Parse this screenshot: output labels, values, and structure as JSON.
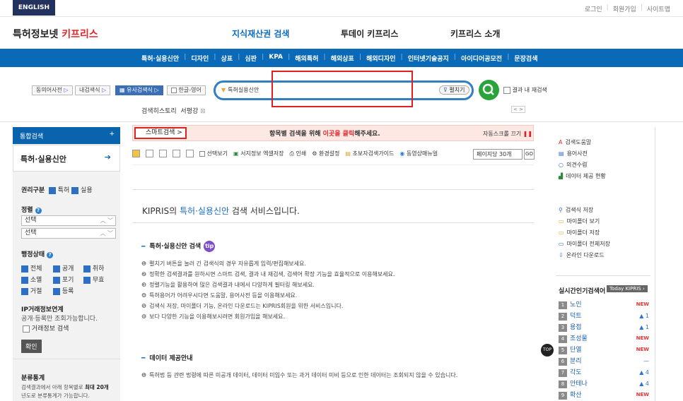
{
  "topbar": {
    "english": "ENGLISH",
    "links": [
      "로그인",
      "회원가입",
      "사이트맵"
    ]
  },
  "logo": {
    "prefix": "특허정보넷 ",
    "brand": "키프리스"
  },
  "mainnav": [
    "지식재산권 검색",
    "투데이 키프리스",
    "키프리스 소개"
  ],
  "subnav": [
    "특허·실용신안",
    "디자인",
    "상표",
    "심판",
    "KPA",
    "해외특허",
    "해외상표",
    "해외디자인",
    "인터넷기술공지",
    "아이디어공모전",
    "문장검색"
  ],
  "searchopts": {
    "synonym": "동의어사전",
    "mysearch": "내검색식",
    "similar": "유사검색식",
    "hangul": "한글-영어"
  },
  "search": {
    "select": "특허실용신안",
    "expand": "펼치기",
    "within": "결과 내 재검색"
  },
  "history": {
    "label": "검색히스토리",
    "term": "서평강"
  },
  "history_nav": "< >",
  "left": {
    "head": "통합검색",
    "selected": "특허·실용신안",
    "rights_label": "권리구분",
    "rights": [
      "특허",
      "실용"
    ],
    "sort_label": "정렬",
    "sort1": "선택",
    "sort2": "선택",
    "status_label": "행정상태",
    "status": [
      "전체",
      "공개",
      "취하",
      "소멸",
      "포기",
      "무효",
      "거절",
      "등록"
    ],
    "ip_title": "IP거래정보연계",
    "ip_desc": "공개·등록만 조회가능합니다.",
    "ip_check": "거래정보 검색",
    "confirm": "확인",
    "class_title": "분류통계",
    "class_desc1": "검색결과에서 아래 항목별로 ",
    "class_desc1b": "최대 20개",
    "class_desc2": "년도로 분류통계가 가능합니다."
  },
  "banner": {
    "smart": "스마트검색 >",
    "msg_prefix": "항목별 검색을 위해 ",
    "msg_link": "이곳을 클릭",
    "msg_suffix": "해주세요.",
    "autoscroll": "자동스크롤 끄기"
  },
  "toolbar": [
    "선택보기",
    "서지정보 엑셀저장",
    "인쇄",
    "환경설정",
    "초보자검색가이드",
    "동영상매뉴얼"
  ],
  "perpage": "페이지당 30개",
  "go": "GO",
  "svc": {
    "prefix": "KIPRIS의 ",
    "hl": "특허·실용신안",
    "suffix": " 검색 서비스입니다."
  },
  "guide_title": "특허·실용신안 검색",
  "tip": "tip",
  "bullets": [
    "펼치기 버튼을 눌러 긴 검색식의 경우 자유롭게 입력/편집해보세요.",
    "정확한 검색결과를 원하시면 스마트 검색, 결과 내 재검색, 검색어 확장 기능을 효율적으로 이용해보세요.",
    "정렬기능을 활용하여 많은 검색결과 내에서 다양하게 필터링 해보세요.",
    "특허용어가 어려우시다면 도움말, 용어사전 등을 이용해보세요.",
    "검색식 저장, 마이폴더 기능, 온라인 다운로드는 KIPRIS회원을 위한 서비스입니다.",
    "보다 다양한 기능을 이용해보시려면 회원가입을 해보세요."
  ],
  "data_title": "데이터 제공안내",
  "data_bullet": "특허법 등 관련 법령에 따른 미공개 데이터, 데이터 미입수 또는 과거 데이터 미비 등으로 인한 데이터는 조회되지 않을 수 있습니다.",
  "right": {
    "links1": [
      "검색도움말",
      "용어사전",
      "의견수렴",
      "데이터 제공 현황"
    ],
    "links2": [
      "검색식 저장",
      "마이폴더 보기",
      "마이폴더 저장",
      "마이폴더 전체저장",
      "온라인 다운로드"
    ],
    "rt_title": "실시간인기검색어",
    "today": "Today KIPRIS ›",
    "ranks": [
      {
        "n": "1",
        "name": "노인",
        "tag": "NEW"
      },
      {
        "n": "2",
        "name": "덕트",
        "tag": "▲ 1"
      },
      {
        "n": "3",
        "name": "용접",
        "tag": "▲ 1"
      },
      {
        "n": "4",
        "name": "조성물",
        "tag": "NEW"
      },
      {
        "n": "5",
        "name": "단열",
        "tag": "NEW"
      },
      {
        "n": "6",
        "name": "분리",
        "tag": "—"
      },
      {
        "n": "7",
        "name": "각도",
        "tag": "▲ 4"
      },
      {
        "n": "8",
        "name": "안테나",
        "tag": "▲ 4"
      },
      {
        "n": "9",
        "name": "확산",
        "tag": "NEW"
      }
    ]
  },
  "topbtn": "TOP",
  "colors": {
    "navy": "#23315f",
    "blue": "#0a6ab8",
    "red": "#e0262a",
    "green": "#2aa43a"
  }
}
